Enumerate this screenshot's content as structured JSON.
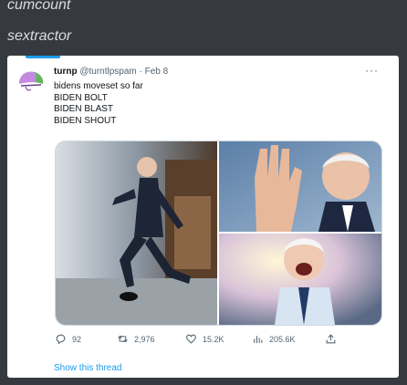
{
  "tags": {
    "first": "cumcount",
    "second": "sextractor"
  },
  "tweet": {
    "display_name": "turnp",
    "handle": "@turntlpspam",
    "separator": "·",
    "date": "Feb 8",
    "text_lines": [
      "bidens moveset so far",
      "BIDEN BOLT",
      "BIDEN BLAST",
      "BIDEN SHOUT"
    ],
    "more_label": "···",
    "actions": {
      "replies": "92",
      "retweets": "2,976",
      "likes": "15.2K",
      "views": "205.6K"
    },
    "show_thread": "Show this thread"
  },
  "colors": {
    "background": "#36393f",
    "card": "#ffffff",
    "link": "#1d9bf0",
    "muted": "#536471"
  },
  "icons": {
    "reply": "reply-icon",
    "retweet": "retweet-icon",
    "like": "heart-icon",
    "views": "views-bar-chart-icon",
    "share": "share-icon"
  }
}
